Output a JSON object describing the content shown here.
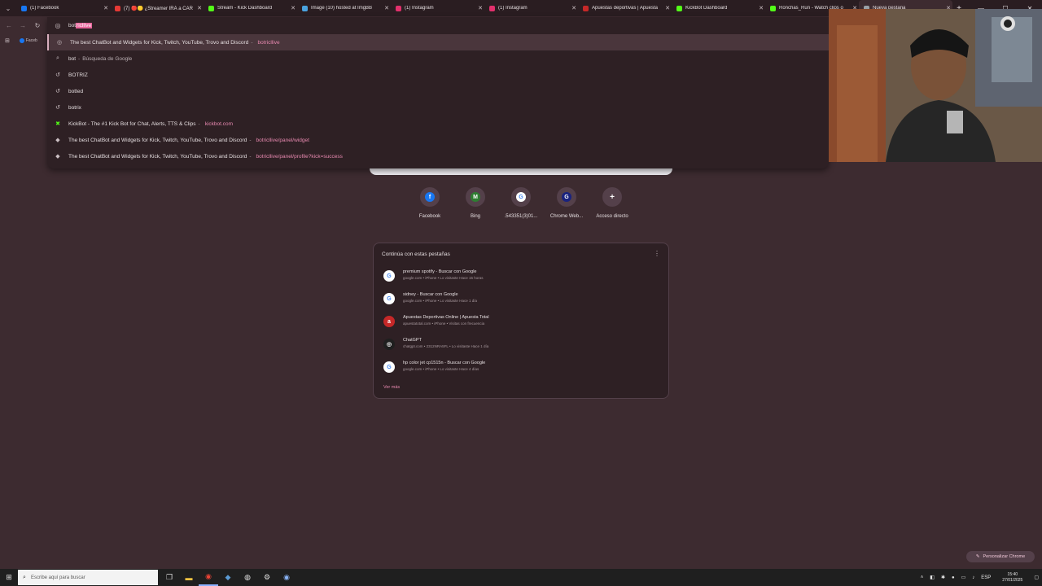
{
  "tabs": [
    {
      "title": "(1) Facebook",
      "color": "#1877f2",
      "active": false
    },
    {
      "title": "(7) 🔴🟡 ¿Streamer IRÁ a CAR",
      "color": "#e53935",
      "active": false
    },
    {
      "title": "Stream - Kick Dashboard",
      "color": "#53fc18",
      "active": false
    },
    {
      "title": "Image (10) hosted at ImgBB",
      "color": "#4aa3df",
      "active": false
    },
    {
      "title": "(1) Instagram",
      "color": "#e1306c",
      "active": false
    },
    {
      "title": "(1) Instagram",
      "color": "#e1306c",
      "active": false
    },
    {
      "title": "Apuestas deportivas | Apuesta",
      "color": "#c62828",
      "active": false
    },
    {
      "title": "KickBot Dashboard",
      "color": "#53fc18",
      "active": false
    },
    {
      "title": "Ronchas_Run - Watch clips o",
      "color": "#53fc18",
      "active": false
    },
    {
      "title": "Nueva pestaña",
      "color": "#9aa0a6",
      "active": true
    }
  ],
  "omnibox": {
    "typed": "bot",
    "autocomplete": "ricllive",
    "suggestions": [
      {
        "icon": "globe-icon",
        "text": "The best ChatBot and Widgets for Kick, Twitch, YouTube, Trovo and Discord",
        "url": "botricllive",
        "highlighted": true
      },
      {
        "icon": "search-icon",
        "text": "bot",
        "suffix": "Búsqueda de Google"
      },
      {
        "icon": "history-icon",
        "text": "BOTRIZ"
      },
      {
        "icon": "history-icon",
        "text": "botted"
      },
      {
        "icon": "history-icon",
        "text": "botrix"
      },
      {
        "icon": "kick-icon",
        "text": "KickBot - The #1 Kick Bot for Chat, Alerts, TTS & Clips",
        "url": "kickbot.com"
      },
      {
        "icon": "site-icon",
        "text": "The best ChatBot and Widgets for Kick, Twitch, YouTube, Trovo and Discord",
        "url": "botricllive/panel/widget"
      },
      {
        "icon": "site-icon",
        "text": "The best ChatBot and Widgets for Kick, Twitch, YouTube, Trovo and Discord",
        "url": "botricllive/panel/profile?kick=success"
      }
    ]
  },
  "shortcuts": [
    {
      "label": "Facebook",
      "glyph": "f",
      "color": "#1877f2"
    },
    {
      "label": "Bing",
      "glyph": "M",
      "color": "#2e7d32"
    },
    {
      "label": ".543351(3)01...",
      "glyph": "G",
      "color": "#ffffff"
    },
    {
      "label": "Chrome Web...",
      "glyph": "G",
      "color": "#1a237e"
    },
    {
      "label": "Acceso directo",
      "glyph": "+",
      "color": "#54404a"
    }
  ],
  "continue": {
    "title": "Continúa con estas pestañas",
    "items": [
      {
        "title": "premium spotify - Buscar con Google",
        "sub": "google.com • iPhone • Lo visitaste Hace 15 horas",
        "icon": "G",
        "color": "#ffffff"
      },
      {
        "title": "sidney - Buscar con Google",
        "sub": "google.com • iPhone • Lo visitaste Hace 1 día",
        "icon": "G",
        "color": "#ffffff"
      },
      {
        "title": "Apuestas Deportivas Online | Apuesta Total",
        "sub": "apuestatotal.com • iPhone • Visitas con frecuencia",
        "icon": "a",
        "color": "#c62828"
      },
      {
        "title": "ChatGPT",
        "sub": "chatgpt.com • 2312NRA5FL • Lo visitaste Hace 1 día",
        "icon": "◎",
        "color": "#1f1f1f"
      },
      {
        "title": "hp color jet cp1515n - Buscar con Google",
        "sub": "google.com • iPhone • Lo visitaste Hace 4 días",
        "icon": "G",
        "color": "#ffffff"
      }
    ],
    "more": "Ver más"
  },
  "bookmark": "Faceb",
  "customize_label": "Personalizar Chrome",
  "taskbar": {
    "search_placeholder": "Escribe aquí para buscar",
    "lang": "ESP",
    "time": "15:40",
    "date": "27/01/2025"
  }
}
